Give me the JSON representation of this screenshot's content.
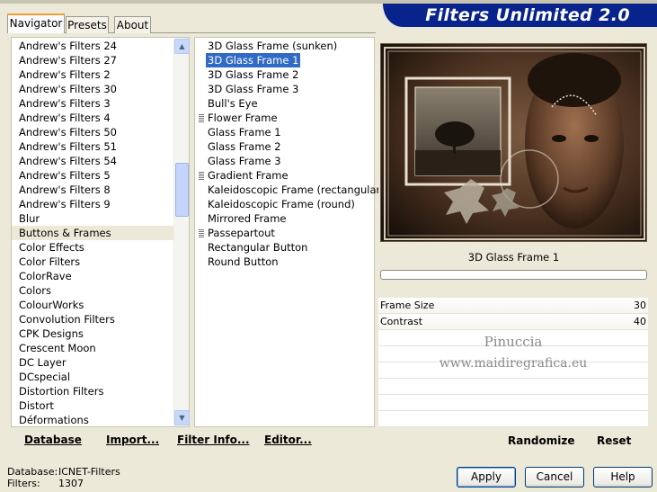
{
  "tabs": [
    {
      "label": "Navigator"
    },
    {
      "label": "Presets"
    },
    {
      "label": "About"
    }
  ],
  "banner": {
    "title": "Filters Unlimited 2.0"
  },
  "categories": {
    "items": [
      "Andrew's Filters 24",
      "Andrew's Filters 27",
      "Andrew's Filters 2",
      "Andrew's Filters 30",
      "Andrew's Filters 3",
      "Andrew's Filters 4",
      "Andrew's Filters 50",
      "Andrew's Filters 51",
      "Andrew's Filters 54",
      "Andrew's Filters 5",
      "Andrew's Filters 8",
      "Andrew's Filters 9",
      "Blur",
      "Buttons & Frames",
      "Color Effects",
      "Color Filters",
      "ColorRave",
      "Colors",
      "ColourWorks",
      "Convolution Filters",
      "CPK Designs",
      "Crescent Moon",
      "DC Layer",
      "DCspecial",
      "Distortion Filters",
      "Distort",
      "Déformations"
    ],
    "selected": "Buttons & Frames"
  },
  "filters": {
    "items": [
      {
        "label": "3D Glass Frame (sunken)",
        "group": false
      },
      {
        "label": "3D Glass Frame 1",
        "group": false
      },
      {
        "label": "3D Glass Frame 2",
        "group": false
      },
      {
        "label": "3D Glass Frame 3",
        "group": false
      },
      {
        "label": "Bull's Eye",
        "group": false
      },
      {
        "label": "Flower Frame",
        "group": true
      },
      {
        "label": "Glass Frame 1",
        "group": false
      },
      {
        "label": "Glass Frame 2",
        "group": false
      },
      {
        "label": "Glass Frame 3",
        "group": false
      },
      {
        "label": "Gradient Frame",
        "group": true
      },
      {
        "label": "Kaleidoscopic Frame (rectangular)",
        "group": false
      },
      {
        "label": "Kaleidoscopic Frame (round)",
        "group": false
      },
      {
        "label": "Mirrored Frame",
        "group": false
      },
      {
        "label": "Passepartout",
        "group": true
      },
      {
        "label": "Rectangular Button",
        "group": false
      },
      {
        "label": "Round Button",
        "group": false
      }
    ],
    "selected": "3D Glass Frame 1"
  },
  "actions": {
    "database": "Database",
    "import": "Import...",
    "filter_info": "Filter Info...",
    "editor": "Editor...",
    "randomize": "Randomize",
    "reset": "Reset"
  },
  "preview": {
    "filter_name": "3D Glass Frame 1",
    "progress": 0
  },
  "params": [
    {
      "label": "Frame Size",
      "value": "30"
    },
    {
      "label": "Contrast",
      "value": "40"
    }
  ],
  "watermark": {
    "line1": "Pinuccia",
    "line2": "www.maidiregrafica.eu"
  },
  "buttons": {
    "apply": "Apply",
    "cancel": "Cancel",
    "help": "Help"
  },
  "status": {
    "database_label": "Database:",
    "database_value": "ICNET-Filters",
    "filters_label": "Filters:",
    "filters_value": "1307"
  },
  "scrollbar": {
    "position": 0.36
  }
}
